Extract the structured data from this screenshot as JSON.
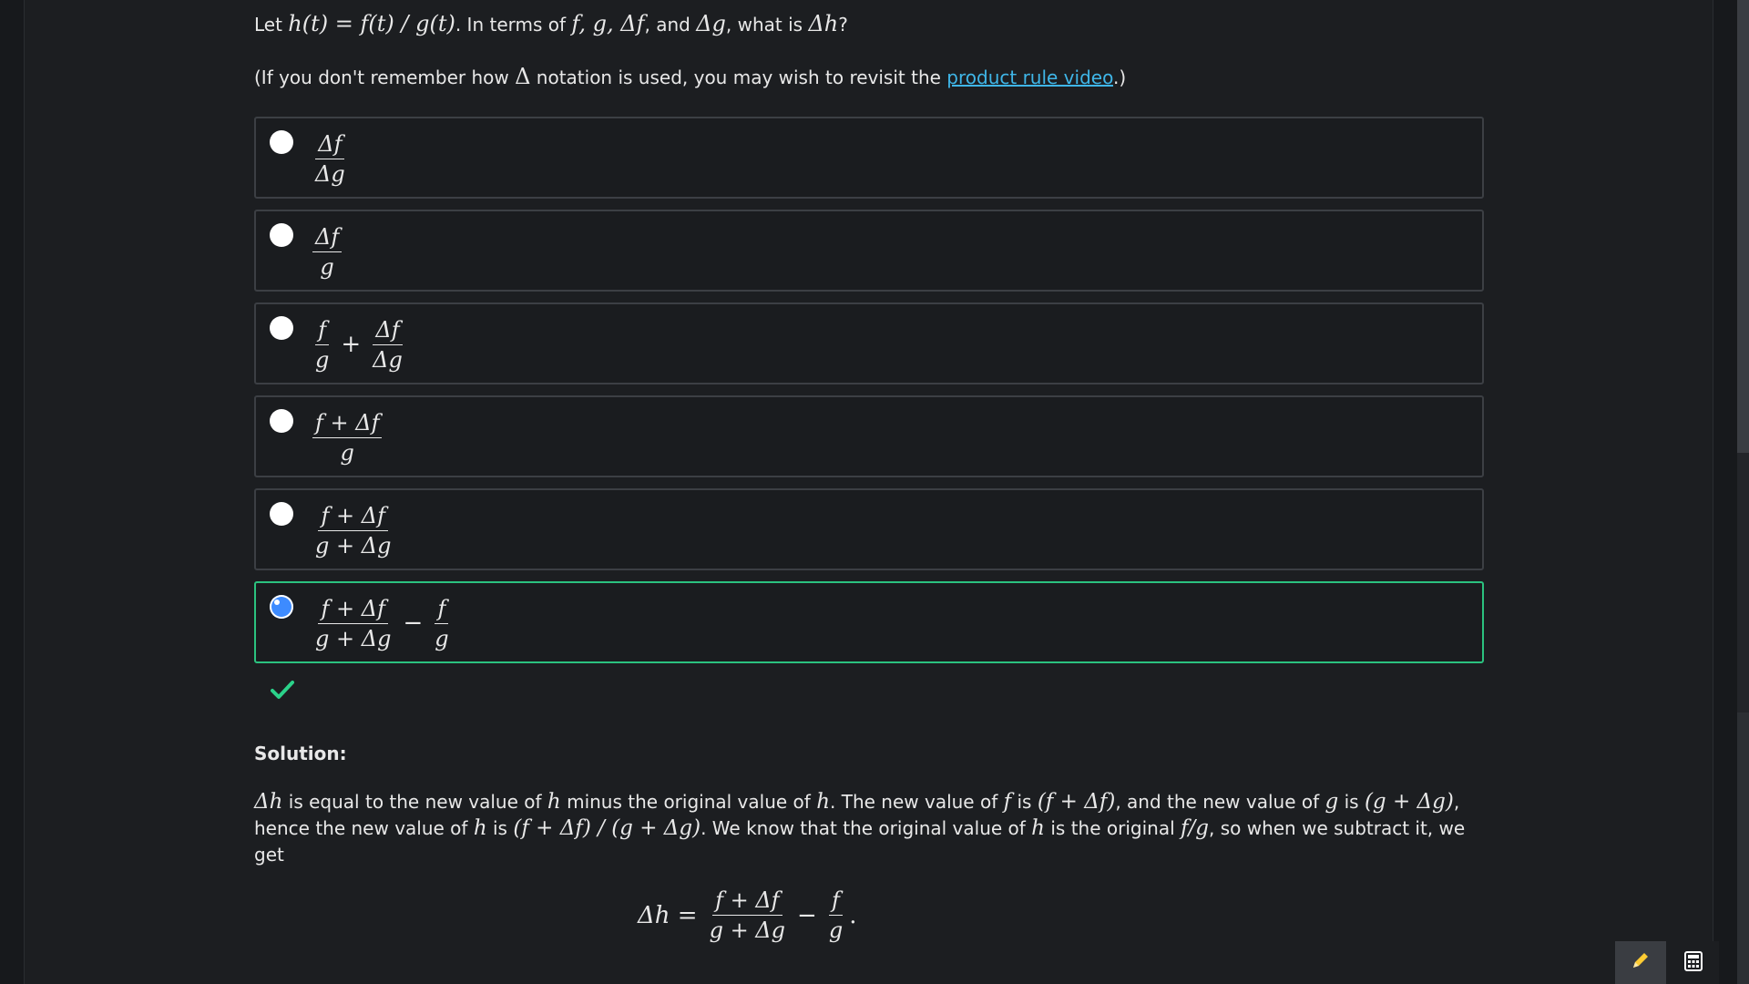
{
  "question": {
    "prefix": "Let ",
    "definition": "h(t) = f(t) / g(t)",
    "middle": ". In terms of ",
    "variables": "f, g, Δf",
    "and_text": ", and ",
    "last_var": "Δg",
    "ask_text": ", what is ",
    "target": "Δh",
    "suffix": "?"
  },
  "hint": {
    "before": "(If you don't remember how ",
    "symbol": "Δ",
    "after": " notation is used, you may wish to revisit the ",
    "link_text": "product rule video",
    "end": ".)"
  },
  "choices": [
    {
      "num": "Δf",
      "den": "Δg"
    },
    {
      "num": "Δf",
      "den": "g"
    },
    {
      "a_num": "f",
      "a_den": "g",
      "op": "+",
      "b_num": "Δf",
      "b_den": "Δg"
    },
    {
      "num": "f + Δf",
      "den": "g"
    },
    {
      "num": "f + Δf",
      "den": "g + Δg"
    },
    {
      "a_num": "f + Δf",
      "a_den": "g + Δg",
      "op": "−",
      "b_num": "f",
      "b_den": "g"
    }
  ],
  "selected_index": 5,
  "check_icon": "checkmark-icon",
  "solution": {
    "title": "Solution:",
    "s1": "Δh",
    "t1": " is equal to the new value of ",
    "s2": "h",
    "t2": " minus the original value of ",
    "s3": "h",
    "t3": ". The new value of ",
    "s4": "f",
    "t4": " is ",
    "s5": "(f + Δf)",
    "t5": ", and the new value of ",
    "s6": "g",
    "t6": " is ",
    "s7": "(g + Δg)",
    "t7": ", hence the new value of ",
    "s8": "h",
    "t8": " is ",
    "s9": "(f + Δf) / (g + Δg)",
    "t9": ". We know that the original value of ",
    "s10": "h",
    "t10": " is the original ",
    "s11": "f/g",
    "t11": ", so when we subtract it, we get"
  },
  "equation": {
    "lhs": "Δh =",
    "a_num": "f + Δf",
    "a_den": "g + Δg",
    "op": "−",
    "b_num": "f",
    "b_den": "g",
    "end": "."
  },
  "tools": {
    "pencil_icon": "pencil-icon",
    "calculator_icon": "calculator-icon"
  },
  "colors": {
    "background": "#1c1e21",
    "link": "#3fb6e8",
    "correct": "#2bc27f",
    "selected_radio": "#3d8bff",
    "pencil": "#ffcc33"
  }
}
